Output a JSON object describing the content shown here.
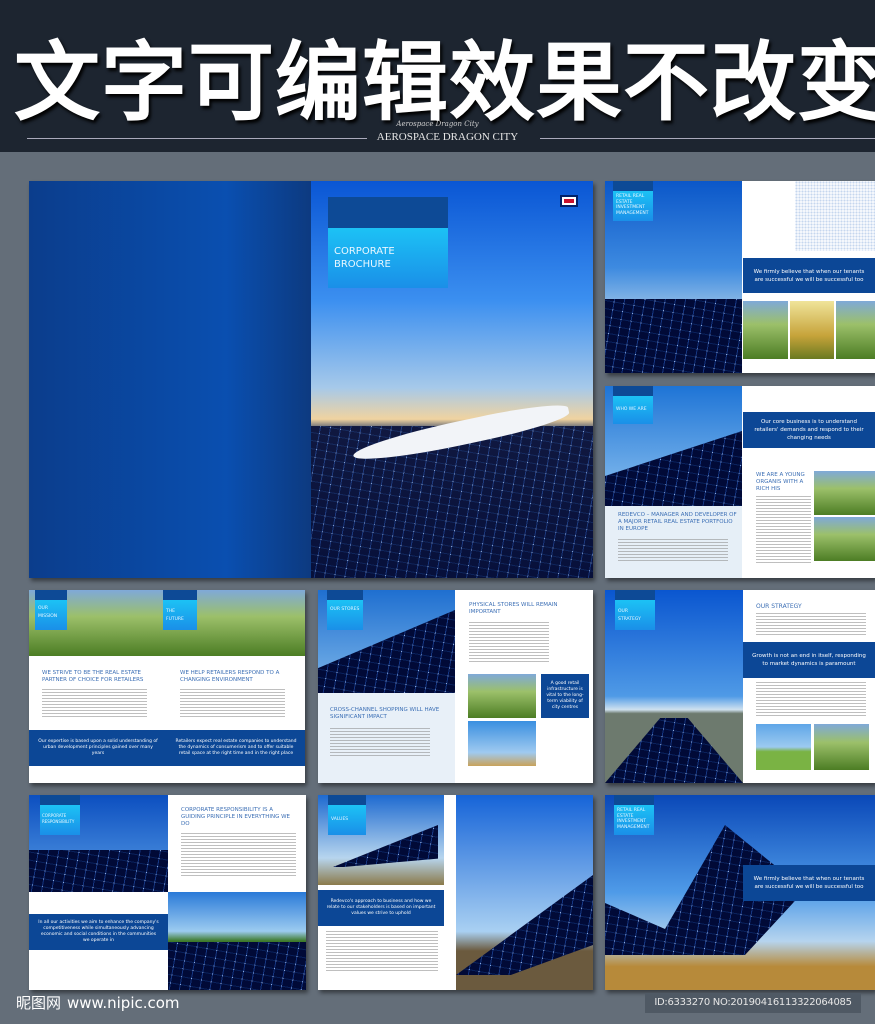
{
  "banner": {
    "title": "文字可编辑效果不改变",
    "script_line": "Aerospace Dragon City",
    "subtitle": "AEROSPACE DRAGON CITY"
  },
  "cover": {
    "title": "CORPORATE BROCHURE",
    "flag_icon": "uk-flag-icon"
  },
  "spread_retail": {
    "label": "RETAIL REAL ESTATE INVESTMENT MANAGEMENT",
    "quote": "We firmly believe that when our tenants are successful we will be successful too"
  },
  "spread_who": {
    "label": "WHO WE ARE",
    "quote": "Our core business is to understand retailers' demands and respond to their changing needs",
    "heading_left": "REDEVCO – MANAGER AND DEVELOPER OF A MAJOR RETAIL REAL ESTATE PORTFOLIO IN EUROPE",
    "heading_right": "WE ARE A YOUNG ORGANIS WITH A RICH HIS"
  },
  "spread_mission": {
    "label_left": "OUR MISSION",
    "label_right": "THE FUTURE",
    "heading_left": "WE STRIVE TO BE THE REAL ESTATE PARTNER OF CHOICE FOR RETAILERS",
    "heading_right": "WE HELP RETAILERS RESPOND TO A CHANGING ENVIRONMENT",
    "quote_left": "Our expertise is based upon a solid understanding of urban development principles gained over many years",
    "quote_right": "Retailers expect real estate companies to understand the dynamics of consumerism and to offer suitable retail space at the right time and in the right place"
  },
  "spread_stores": {
    "label": "OUR STORES",
    "heading_right": "PHYSICAL STORES WILL REMAIN IMPORTANT",
    "heading_left": "CROSS-CHANNEL SHOPPING WILL HAVE SIGNIFICANT IMPACT",
    "quote": "A good retail infrastructure is vital to the long-term viability of city centres"
  },
  "spread_strategy": {
    "label": "OUR STRATEGY",
    "heading": "OUR STRATEGY",
    "quote": "Growth is not an end in itself, responding to market dynamics is paramount"
  },
  "spread_csr": {
    "label": "CORPORATE RESPONSIBILITY",
    "heading": "CORPORATE RESPONSIBILITY IS A GUIDING PRINCIPLE IN EVERYTHING WE DO",
    "quote": "In all our activities we aim to enhance the company's competitiveness while simultaneously advancing economic and social conditions in the communities we operate in"
  },
  "spread_values": {
    "label": "VALUES",
    "quote": "Redevco's approach to business and how we relate to our stakeholders is based on important values we strive to uphold"
  },
  "spread_last": {
    "label": "RETAIL REAL ESTATE INVESTMENT MANAGEMENT",
    "quote": "We firmly believe that when our tenants are successful we will be successful too"
  },
  "footer": {
    "watermark_cn": "昵图网",
    "watermark_url": "www.nipic.com",
    "id_text": "ID:6333270 NO:20190416113322064085"
  }
}
